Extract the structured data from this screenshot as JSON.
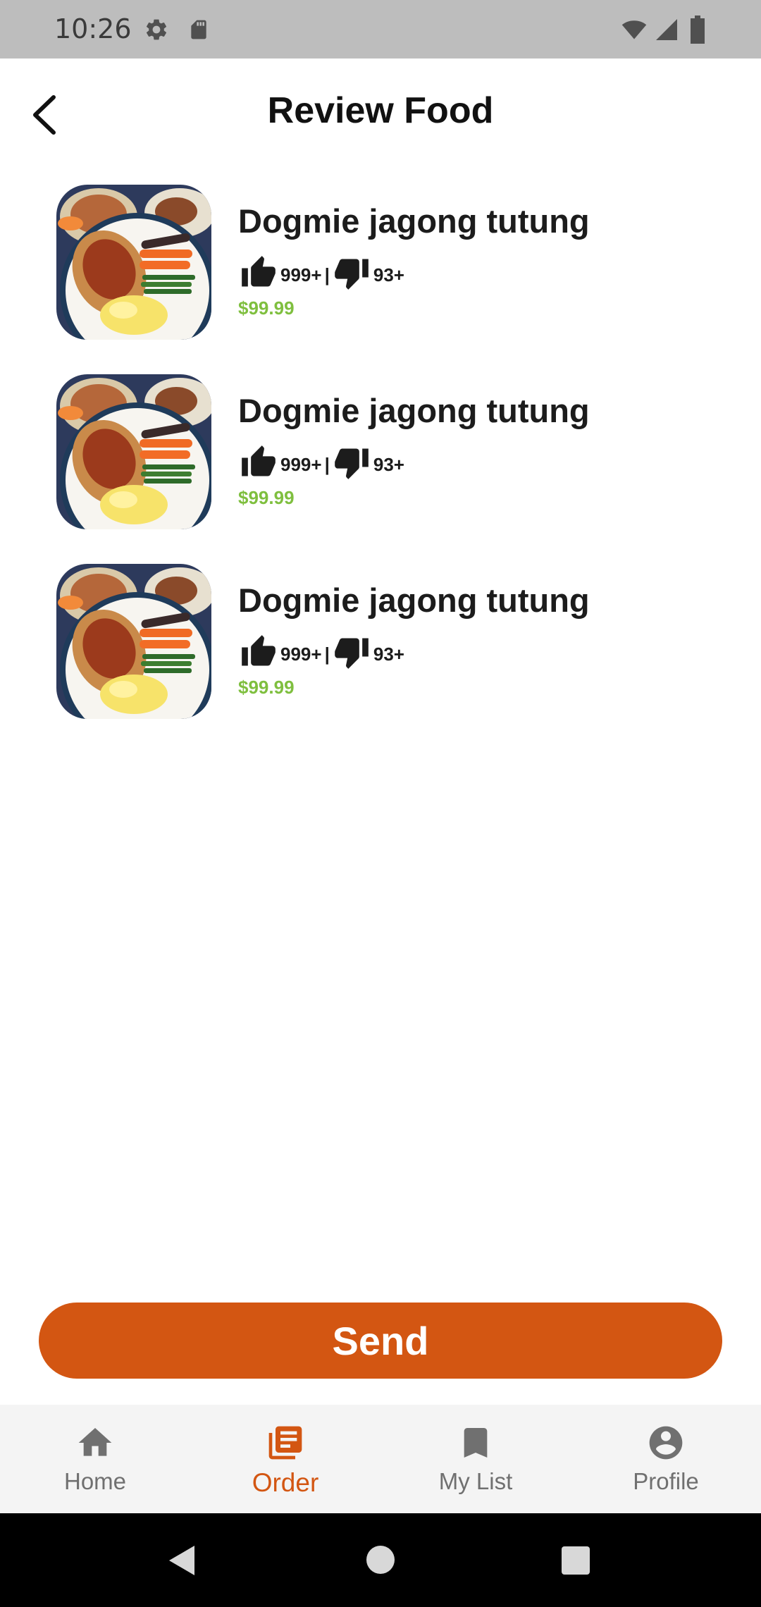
{
  "status_bar": {
    "time": "10:26",
    "left_icons": [
      "settings-icon",
      "sd-card-icon"
    ],
    "right_icons": [
      "wifi-icon",
      "cellular-signal-icon",
      "battery-icon"
    ]
  },
  "header": {
    "title": "Review Food",
    "back_icon": "chevron-left-icon"
  },
  "items": [
    {
      "name": "Dogmie jagong tutung",
      "likes": "999+",
      "separator": "|",
      "dislikes": "93+",
      "price": "$99.99"
    },
    {
      "name": "Dogmie jagong tutung",
      "likes": "999+",
      "separator": "|",
      "dislikes": "93+",
      "price": "$99.99"
    },
    {
      "name": "Dogmie jagong tutung",
      "likes": "999+",
      "separator": "|",
      "dislikes": "93+",
      "price": "$99.99"
    }
  ],
  "send_label": "Send",
  "nav": {
    "items": [
      {
        "label": "Home",
        "icon": "home-icon"
      },
      {
        "label": "Order",
        "icon": "order-list-icon"
      },
      {
        "label": "My List",
        "icon": "bookmark-icon"
      },
      {
        "label": "Profile",
        "icon": "account-circle-icon"
      }
    ],
    "active": "Order"
  },
  "colors": {
    "accent": "#d35612",
    "price": "#7fbf3f",
    "status_bar": "#bdbdbd",
    "nav_inactive": "#707070"
  }
}
